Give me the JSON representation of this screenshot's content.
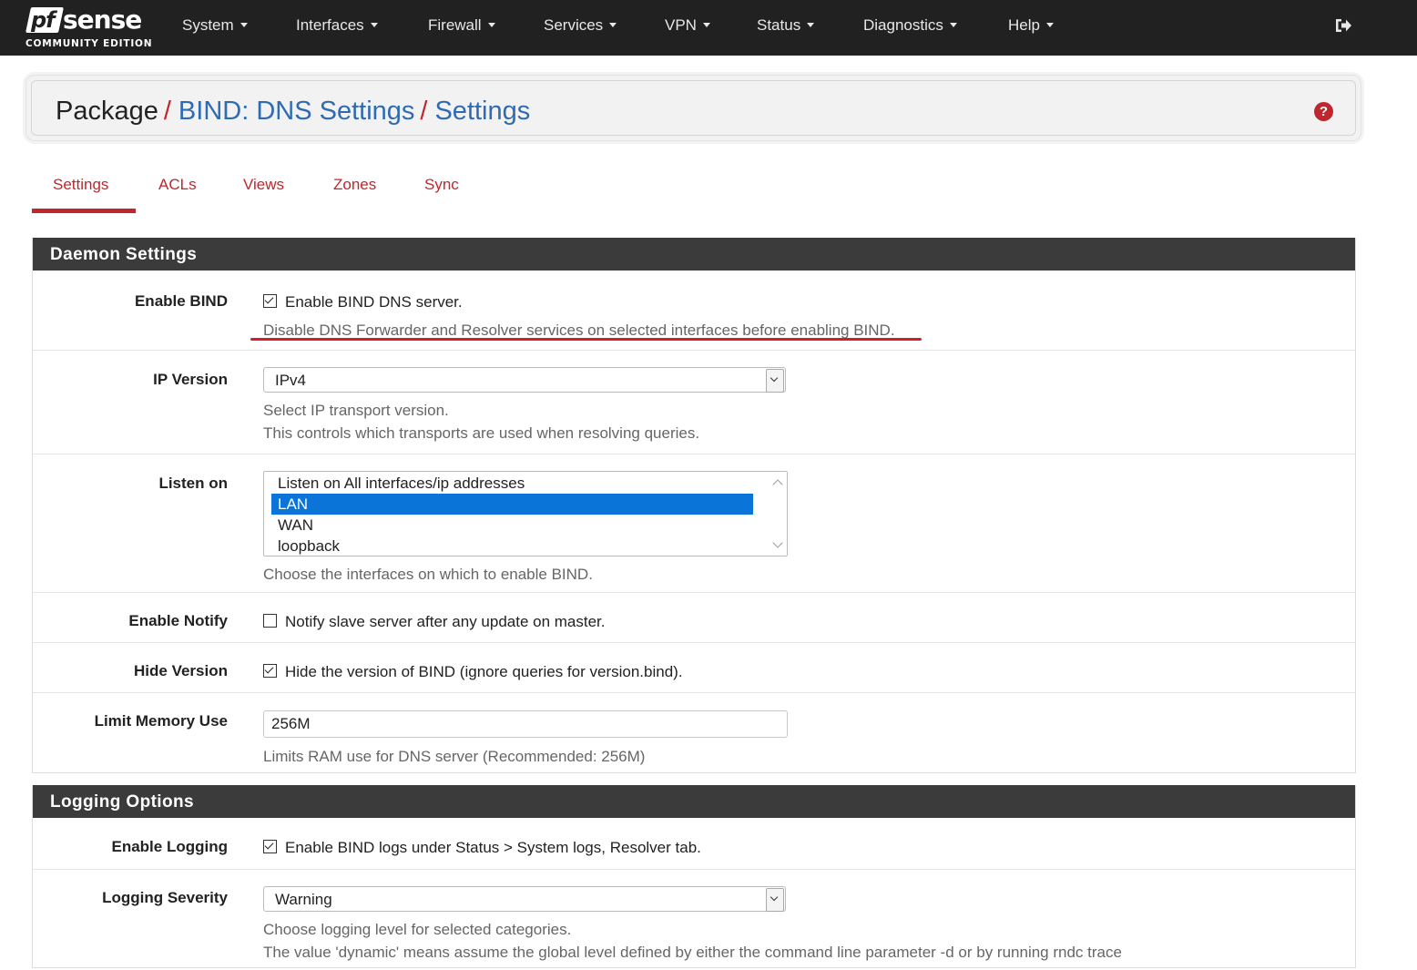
{
  "brand": {
    "logo_mark": "pf",
    "logo_word": "sense",
    "edition": "COMMUNITY EDITION"
  },
  "nav": {
    "items": [
      {
        "label": "System"
      },
      {
        "label": "Interfaces"
      },
      {
        "label": "Firewall"
      },
      {
        "label": "Services"
      },
      {
        "label": "VPN"
      },
      {
        "label": "Status"
      },
      {
        "label": "Diagnostics"
      },
      {
        "label": "Help"
      }
    ],
    "logout_icon": "sign-out-icon"
  },
  "breadcrumb": {
    "root": "Package",
    "pkg": "BIND: DNS Settings",
    "page": "Settings",
    "separator": "/",
    "help_icon": "question-circle-icon",
    "help_glyph": "?"
  },
  "tabs": [
    {
      "label": "Settings",
      "active": true
    },
    {
      "label": "ACLs"
    },
    {
      "label": "Views"
    },
    {
      "label": "Zones"
    },
    {
      "label": "Sync"
    }
  ],
  "daemon": {
    "title": "Daemon Settings",
    "enable_bind": {
      "label": "Enable BIND",
      "checked": true,
      "text": "Enable BIND DNS server.",
      "help": "Disable DNS Forwarder and Resolver services on selected interfaces before enabling BIND."
    },
    "ip_version": {
      "label": "IP Version",
      "value": "IPv4",
      "help1": "Select IP transport version.",
      "help2": "This controls which transports are used when resolving queries."
    },
    "listen_on": {
      "label": "Listen on",
      "options": [
        "Listen on All interfaces/ip addresses",
        "LAN",
        "WAN",
        "loopback"
      ],
      "selected": "LAN",
      "help": "Choose the interfaces on which to enable BIND."
    },
    "enable_notify": {
      "label": "Enable Notify",
      "checked": false,
      "text": "Notify slave server after any update on master."
    },
    "hide_version": {
      "label": "Hide Version",
      "checked": true,
      "text": "Hide the version of BIND (ignore queries for version.bind)."
    },
    "limit_memory": {
      "label": "Limit Memory Use",
      "value": "256M",
      "help": "Limits RAM use for DNS server (Recommended: 256M)"
    }
  },
  "logging": {
    "title": "Logging Options",
    "enable_logging": {
      "label": "Enable Logging",
      "checked": true,
      "text": "Enable BIND logs under Status > System logs, Resolver tab."
    },
    "severity": {
      "label": "Logging Severity",
      "value": "Warning",
      "help1": "Choose logging level for selected categories.",
      "help2": "The value 'dynamic' means assume the global level defined by either the command line parameter -d or by running rndc trace"
    }
  },
  "colors": {
    "accent": "#c0262d",
    "link": "#2f6bb3",
    "navbar": "#212121",
    "panel_header": "#3b3b3b",
    "selection": "#0a74d9"
  }
}
